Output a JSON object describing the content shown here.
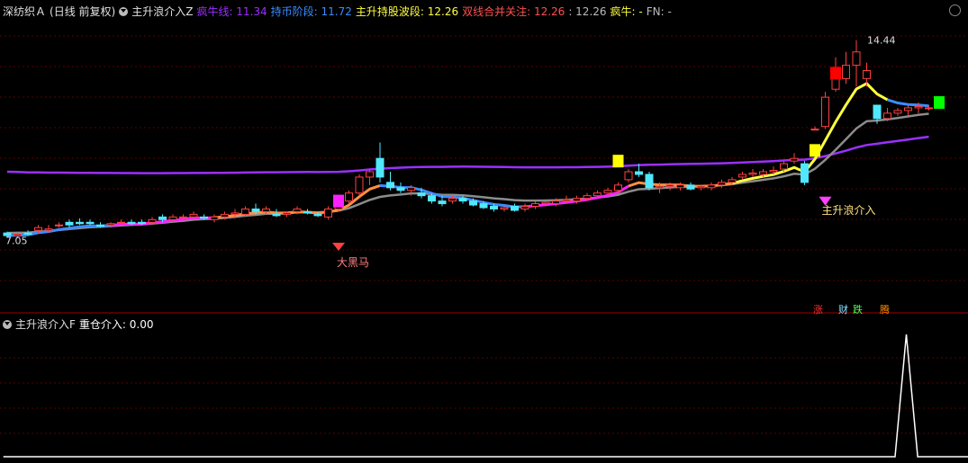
{
  "header_main": {
    "stock": "深纺织Ａ",
    "period": "(日线 前复权)",
    "indicator": "主升浪介入Z",
    "items": [
      {
        "label": "疯牛线:",
        "value": "11.34",
        "color": "#9b30ff"
      },
      {
        "label": "持币阶段:",
        "value": "11.72",
        "color": "#3c8cff"
      },
      {
        "label": "主升持股波段:",
        "value": "12.26",
        "color": "#ffff40"
      },
      {
        "label": "双线合并关注:",
        "value": "12.26",
        "color": "#ff5050"
      },
      {
        "label": ":",
        "value": "12.26",
        "color": "#bbbbbb"
      },
      {
        "label": "疯牛:",
        "value": "-",
        "color": "#ffff40"
      },
      {
        "label": "FN:",
        "value": "-",
        "color": "#bbbbbb"
      }
    ]
  },
  "header_sub": {
    "indicator": "主升浪介入F",
    "items": [
      {
        "label": "重仓介入:",
        "value": "0.00",
        "color": "#ffffff"
      }
    ]
  },
  "badges": [
    {
      "text": "涨",
      "color": "#ff3030"
    },
    {
      "text": "财",
      "color": "#80e0ff"
    },
    {
      "text": "跌",
      "color": "#50ff50"
    },
    {
      "text": "腾",
      "color": "#ff8c00"
    }
  ],
  "colors": {
    "up": "#ff4040",
    "down": "#50e8ff",
    "purple": "#9b30ff",
    "blue": "#3c8cff",
    "yellow": "#ffff40",
    "gray": "#8c8c8c",
    "magenta": "#ff20ff",
    "orange": "#ff9040"
  },
  "chart_data": [
    {
      "type": "candlestick",
      "price_max_label": "14.44",
      "price_min_label": "7.05",
      "candles": [
        [
          7.2,
          7.25,
          7.05,
          7.1
        ],
        [
          7.1,
          7.2,
          7.0,
          7.15
        ],
        [
          7.2,
          7.3,
          7.1,
          7.15
        ],
        [
          7.3,
          7.5,
          7.2,
          7.4
        ],
        [
          7.3,
          7.5,
          7.2,
          7.35
        ],
        [
          7.5,
          7.6,
          7.4,
          7.5
        ],
        [
          7.6,
          7.7,
          7.4,
          7.5
        ],
        [
          7.6,
          7.75,
          7.5,
          7.55
        ],
        [
          7.6,
          7.7,
          7.5,
          7.55
        ],
        [
          7.5,
          7.6,
          7.4,
          7.45
        ],
        [
          7.5,
          7.6,
          7.4,
          7.55
        ],
        [
          7.6,
          7.7,
          7.5,
          7.6
        ],
        [
          7.6,
          7.7,
          7.5,
          7.55
        ],
        [
          7.6,
          7.7,
          7.5,
          7.55
        ],
        [
          7.6,
          7.8,
          7.5,
          7.7
        ],
        [
          7.8,
          7.9,
          7.6,
          7.7
        ],
        [
          7.7,
          7.9,
          7.6,
          7.8
        ],
        [
          7.8,
          7.9,
          7.7,
          7.8
        ],
        [
          7.8,
          8.0,
          7.7,
          7.9
        ],
        [
          7.8,
          7.9,
          7.7,
          7.75
        ],
        [
          7.7,
          7.9,
          7.6,
          7.8
        ],
        [
          7.8,
          8.0,
          7.7,
          7.9
        ],
        [
          7.9,
          8.1,
          7.8,
          7.95
        ],
        [
          7.9,
          8.2,
          7.8,
          8.1
        ],
        [
          8.1,
          8.3,
          7.9,
          8.0
        ],
        [
          8.0,
          8.2,
          7.9,
          8.1
        ],
        [
          7.9,
          8.1,
          7.8,
          7.85
        ],
        [
          7.9,
          8.0,
          7.8,
          7.95
        ],
        [
          8.0,
          8.2,
          7.9,
          8.1
        ],
        [
          8.0,
          8.1,
          7.9,
          7.95
        ],
        [
          7.9,
          8.0,
          7.8,
          7.85
        ],
        [
          7.8,
          8.2,
          7.7,
          8.1
        ],
        [
          8.1,
          8.3,
          8.0,
          8.2
        ],
        [
          8.4,
          8.8,
          8.3,
          8.7
        ],
        [
          8.7,
          9.4,
          8.6,
          9.3
        ],
        [
          9.3,
          9.6,
          9.0,
          9.5
        ],
        [
          10.0,
          10.6,
          9.1,
          9.3
        ],
        [
          9.1,
          9.5,
          8.8,
          8.9
        ],
        [
          8.9,
          9.1,
          8.7,
          8.8
        ],
        [
          8.8,
          9.0,
          8.6,
          8.9
        ],
        [
          8.7,
          8.9,
          8.5,
          8.6
        ],
        [
          8.6,
          8.7,
          8.3,
          8.4
        ],
        [
          8.4,
          8.6,
          8.2,
          8.3
        ],
        [
          8.4,
          8.6,
          8.3,
          8.5
        ],
        [
          8.5,
          8.6,
          8.3,
          8.4
        ],
        [
          8.4,
          8.5,
          8.2,
          8.25
        ],
        [
          8.3,
          8.4,
          8.1,
          8.15
        ],
        [
          8.2,
          8.3,
          8.0,
          8.1
        ],
        [
          8.1,
          8.2,
          8.0,
          8.15
        ],
        [
          8.2,
          8.3,
          8.0,
          8.05
        ],
        [
          8.1,
          8.3,
          8.0,
          8.2
        ],
        [
          8.2,
          8.4,
          8.1,
          8.3
        ],
        [
          8.3,
          8.4,
          8.2,
          8.35
        ],
        [
          8.3,
          8.5,
          8.2,
          8.4
        ],
        [
          8.4,
          8.6,
          8.3,
          8.45
        ],
        [
          8.4,
          8.6,
          8.3,
          8.5
        ],
        [
          8.5,
          8.7,
          8.4,
          8.6
        ],
        [
          8.6,
          8.8,
          8.5,
          8.7
        ],
        [
          8.7,
          8.9,
          8.6,
          8.8
        ],
        [
          8.8,
          9.1,
          8.7,
          9.0
        ],
        [
          9.2,
          9.6,
          9.1,
          9.5
        ],
        [
          9.5,
          9.8,
          9.3,
          9.4
        ],
        [
          9.4,
          9.5,
          8.8,
          8.9
        ],
        [
          8.9,
          9.1,
          8.7,
          8.95
        ],
        [
          8.95,
          9.1,
          8.8,
          9.0
        ],
        [
          8.9,
          9.1,
          8.8,
          9.0
        ],
        [
          9.0,
          9.1,
          8.8,
          8.85
        ],
        [
          8.9,
          9.0,
          8.8,
          8.95
        ],
        [
          8.9,
          9.1,
          8.8,
          9.0
        ],
        [
          9.0,
          9.2,
          8.9,
          9.1
        ],
        [
          9.1,
          9.3,
          9.0,
          9.2
        ],
        [
          9.3,
          9.5,
          9.2,
          9.4
        ],
        [
          9.4,
          9.6,
          9.3,
          9.45
        ],
        [
          9.4,
          9.6,
          9.3,
          9.5
        ],
        [
          9.5,
          9.7,
          9.4,
          9.55
        ],
        [
          9.6,
          9.9,
          9.5,
          9.8
        ],
        [
          9.9,
          10.2,
          9.8,
          10.0
        ],
        [
          9.8,
          9.9,
          9.0,
          9.1
        ],
        [
          11.1,
          11.2,
          11.1,
          11.1
        ],
        [
          11.2,
          12.5,
          11.1,
          12.3
        ],
        [
          12.6,
          13.8,
          12.5,
          13.0
        ],
        [
          13.0,
          14.0,
          12.8,
          13.5
        ],
        [
          13.5,
          14.44,
          12.7,
          14.0
        ],
        [
          13.0,
          13.6,
          12.7,
          13.3
        ],
        [
          12.0,
          12.0,
          11.3,
          11.5
        ],
        [
          11.5,
          11.9,
          11.4,
          11.7
        ],
        [
          11.7,
          11.9,
          11.6,
          11.8
        ],
        [
          11.8,
          12.0,
          11.6,
          11.9
        ],
        [
          11.9,
          12.1,
          11.7,
          11.95
        ],
        [
          11.9,
          12.0,
          11.8,
          11.9
        ]
      ]
    },
    {
      "type": "line",
      "values": [
        0,
        0,
        0,
        0,
        0,
        0,
        0,
        0,
        0,
        0,
        0,
        0,
        0,
        0,
        0,
        0,
        0,
        0,
        0,
        0,
        0,
        0,
        0,
        0,
        0,
        0,
        0,
        0,
        0,
        0,
        0,
        0,
        0,
        0,
        0,
        0,
        0,
        0,
        0,
        0,
        0,
        0,
        0,
        0,
        0,
        0,
        0,
        0,
        0,
        0,
        0,
        0,
        0,
        0,
        0,
        0,
        0,
        0,
        0,
        0,
        0,
        0,
        0,
        0,
        0,
        0,
        0,
        0,
        0,
        0,
        0,
        0,
        0,
        0,
        0,
        0,
        0,
        0,
        0,
        0,
        1,
        0,
        0,
        0,
        0,
        0,
        0,
        0,
        0,
        0
      ],
      "annotations": [
        "主升浪介入",
        "大黑马"
      ]
    }
  ]
}
